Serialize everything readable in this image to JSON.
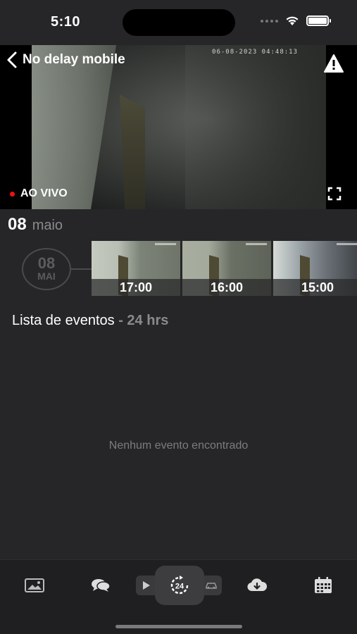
{
  "status_bar": {
    "time": "5:10"
  },
  "player": {
    "title": "No delay mobile",
    "live_label": "AO VIVO",
    "osd_text": "06-08-2023 04:48:13",
    "icons": [
      "chevron-left-icon",
      "warning-icon",
      "fullscreen-icon"
    ]
  },
  "date_header": {
    "day": "08",
    "month": "maio"
  },
  "timeline": {
    "date_badge": {
      "day": "08",
      "month": "MAI"
    },
    "thumbnails": [
      {
        "time": "17:00"
      },
      {
        "time": "16:00"
      },
      {
        "time": "15:00"
      }
    ]
  },
  "events": {
    "title": "Lista de eventos",
    "range_suffix": "- 24 hrs",
    "empty_message": "Nenhum evento encontrado"
  },
  "tabbar": {
    "items": [
      "gallery-icon",
      "chat-icon",
      "play-icon",
      "24h-icon",
      "car-icon",
      "cloud-download-icon",
      "calendar-icon"
    ],
    "active": "24h-icon"
  },
  "colors": {
    "background": "#262629",
    "live_dot": "#ee1111",
    "muted_text": "#8a8a8d"
  }
}
